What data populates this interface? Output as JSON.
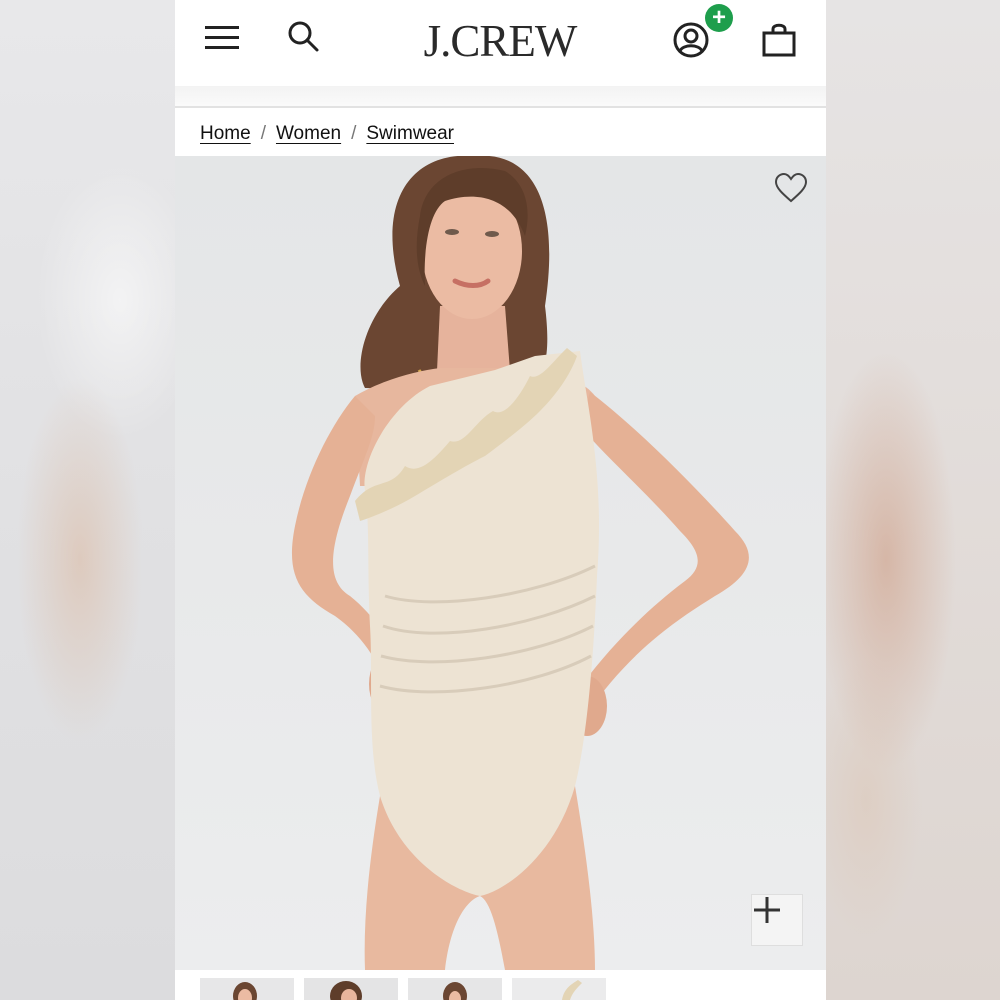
{
  "brand": {
    "logo_text": "J.CREW"
  },
  "header": {
    "menu_icon": "hamburger-menu-icon",
    "search_icon": "search-icon",
    "account_icon": "account-icon",
    "account_badge": "+",
    "bag_icon": "shopping-bag-icon"
  },
  "breadcrumb": {
    "items": [
      "Home",
      "Women",
      "Swimwear"
    ],
    "separator": "/"
  },
  "product": {
    "favorite_icon": "heart-icon",
    "zoom_icon": "plus-icon",
    "thumbnail_count": 4
  },
  "colors": {
    "badge_green": "#1e9e4c",
    "swimsuit": "#ede3d3",
    "background": "#e6e7e8"
  }
}
